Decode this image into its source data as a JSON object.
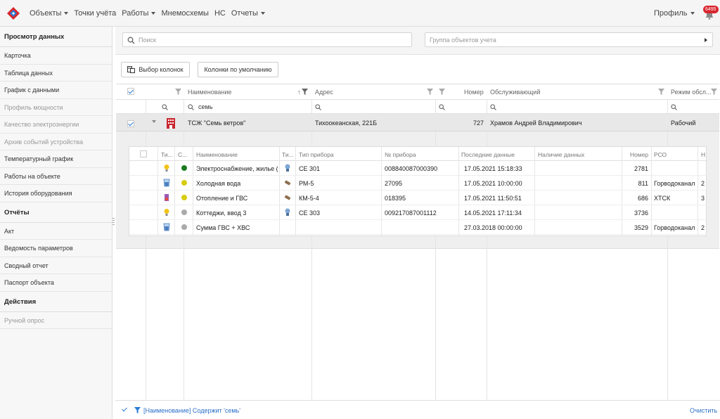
{
  "nav": {
    "items": [
      {
        "label": "Объекты",
        "dropdown": true
      },
      {
        "label": "Точки учёта",
        "dropdown": false
      },
      {
        "label": "Работы",
        "dropdown": true
      },
      {
        "label": "Мнемосхемы",
        "dropdown": false
      },
      {
        "label": "НС",
        "dropdown": false
      },
      {
        "label": "Отчеты",
        "dropdown": true
      }
    ],
    "profile": "Профиль",
    "notifications": "6495",
    "brand_colors": [
      "#d9262e",
      "#2a7bd6"
    ]
  },
  "sidebar": {
    "sections": [
      {
        "title": "Просмотр данных",
        "items": [
          {
            "label": "Карточка",
            "disabled": false
          },
          {
            "label": "Таблица данных",
            "disabled": false
          },
          {
            "label": "График с данными",
            "disabled": false
          },
          {
            "label": "Профиль мощности",
            "disabled": true
          },
          {
            "label": "Качество электроэнергии",
            "disabled": true
          },
          {
            "label": "Архив событий устройства",
            "disabled": true
          },
          {
            "label": "Температурный график",
            "disabled": false
          },
          {
            "label": "Работы на объекте",
            "disabled": false
          },
          {
            "label": "История оборудования",
            "disabled": false
          }
        ]
      },
      {
        "title": "Отчёты",
        "items": [
          {
            "label": "Акт",
            "disabled": false
          },
          {
            "label": "Ведомость параметров",
            "disabled": false
          },
          {
            "label": "Сводный отчет",
            "disabled": false
          },
          {
            "label": "Паспорт объекта",
            "disabled": false
          }
        ]
      },
      {
        "title": "Действия",
        "items": [
          {
            "label": "Ручной опрос",
            "disabled": true
          }
        ]
      }
    ]
  },
  "filters": {
    "search_placeholder": "Поиск",
    "group_placeholder": "Группа объектов учета"
  },
  "toolbar": {
    "columns_button": "Выбор колонок",
    "default_columns_button": "Колонки по умолчанию"
  },
  "grid": {
    "headers": {
      "name": "Наименование",
      "address": "Адрес",
      "number": "Номер",
      "serving": "Обслуживающий",
      "mode": "Режим обсл..."
    },
    "name_filter_value": "семь",
    "row": {
      "name": "ТСЖ \"Семь ветров\"",
      "address": "Тихоокеанская, 221Б",
      "number": "727",
      "serving": "Храмов Андрей Владимирович",
      "mode": "Рабочий"
    }
  },
  "detail": {
    "headers": {
      "type": "Ти...",
      "state": "С...",
      "name": "Наименование",
      "type2": "Ти...",
      "device_type": "Тип прибора",
      "device_no": "№ прибора",
      "last_data": "Последние данные",
      "has_data": "Наличие данных",
      "number": "Номер",
      "rso": "РСО",
      "extra": "Н"
    },
    "rows": [
      {
        "type_icon": "lightbulb-icon",
        "status_color": "#1e7a1e",
        "name": "Электроснабжение, жилье (...",
        "device_icon": "meter-electric-icon",
        "device_type": "CE 301",
        "device_no": "008840087000390",
        "last_data": "17.05.2021 15:18:33",
        "has_data": "",
        "number": "2781",
        "rso": "",
        "extra": ""
      },
      {
        "type_icon": "cold-water-icon",
        "status_color": "#d8cc11",
        "name": "Холодная вода",
        "device_icon": "meter-water-icon",
        "device_type": "РМ-5",
        "device_no": "27095",
        "last_data": "17.05.2021 10:00:00",
        "has_data": "",
        "number": "811",
        "rso": "Горводоканал",
        "extra": "2"
      },
      {
        "type_icon": "heating-icon",
        "status_color": "#d8cc11",
        "name": "Отопление и ГВС",
        "device_icon": "meter-water-icon",
        "device_type": "КМ-5-4",
        "device_no": "018395",
        "last_data": "17.05.2021 11:50:51",
        "has_data": "",
        "number": "686",
        "rso": "ХТСК",
        "extra": "3"
      },
      {
        "type_icon": "lightbulb-icon",
        "status_color": "#aaaaaa",
        "name": "Коттеджи, ввод 3",
        "device_icon": "meter-electric-icon",
        "device_type": "CE 303",
        "device_no": "009217087001112",
        "last_data": "14.05.2021 17:11:34",
        "has_data": "",
        "number": "3736",
        "rso": "",
        "extra": ""
      },
      {
        "type_icon": "cold-water-icon",
        "status_color": "#aaaaaa",
        "name": "Сумма ГВС + ХВС",
        "device_icon": "",
        "device_type": "",
        "device_no": "",
        "last_data": "27.03.2018 00:00:00",
        "has_data": "",
        "number": "3529",
        "rso": "Горводоканал",
        "extra": "2"
      }
    ]
  },
  "status": {
    "filter_text": "[Наименование] Содержит 'семь'",
    "clear": "Очистить"
  }
}
